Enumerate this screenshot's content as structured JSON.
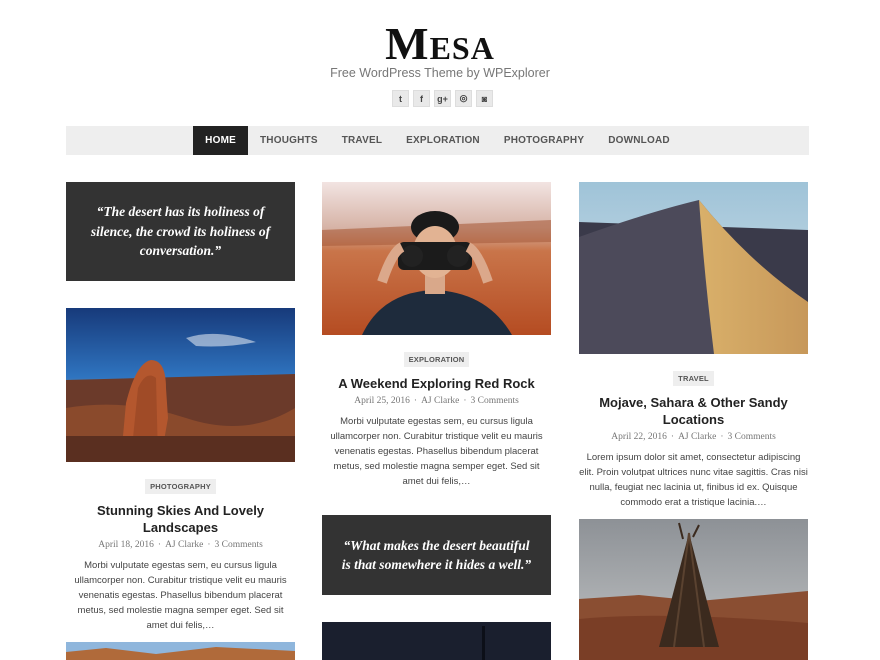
{
  "site": {
    "title": "Mesa",
    "tagline": "Free WordPress Theme by WPExplorer"
  },
  "social": [
    {
      "icon": "twitter-icon",
      "glyph": "t"
    },
    {
      "icon": "facebook-icon",
      "glyph": "f"
    },
    {
      "icon": "google-plus-icon",
      "glyph": "g+"
    },
    {
      "icon": "dribbble-icon",
      "glyph": "◎"
    },
    {
      "icon": "instagram-icon",
      "glyph": "◙"
    }
  ],
  "nav": {
    "items": [
      "HOME",
      "THOUGHTS",
      "TRAVEL",
      "EXPLORATION",
      "PHOTOGRAPHY",
      "DOWNLOAD"
    ],
    "active": "HOME"
  },
  "quotes": [
    "“The desert has its holiness of silence, the crowd its holiness of conversation.”",
    "“What makes the desert beautiful is that somewhere it hides a well.”"
  ],
  "posts": [
    {
      "category": "PHOTOGRAPHY",
      "title": "Stunning Skies And Lovely Landscapes",
      "date": "April 18, 2016",
      "author": "AJ Clarke",
      "comments": "3 Comments",
      "excerpt": "Morbi vulputate egestas sem, eu cursus ligula ullamcorper non. Curabitur tristique velit eu mauris venenatis egestas. Phasellus bibendum placerat metus, sed molestie magna semper eget. Sed sit amet dui felis,…"
    },
    {
      "category": "EXPLORATION",
      "title": "A Weekend Exploring Red Rock",
      "date": "April 25, 2016",
      "author": "AJ Clarke",
      "comments": "3 Comments",
      "excerpt": "Morbi vulputate egestas sem, eu cursus ligula ullamcorper non. Curabitur tristique velit eu mauris venenatis egestas. Phasellus bibendum placerat metus, sed molestie magna semper eget. Sed sit amet dui felis,…"
    },
    {
      "category": "TRAVEL",
      "title": "Mojave, Sahara & Other Sandy Locations",
      "date": "April 22, 2016",
      "author": "AJ Clarke",
      "comments": "3 Comments",
      "excerpt": "Lorem ipsum dolor sit amet, consectetur adipiscing elit. Proin volutpat ultrices nunc vitae sagittis. Cras nisi nulla, feugiat nec lacinia ut, finibus id ex. Quisque commodo erat a tristique lacinia.…"
    }
  ],
  "colors": {
    "nav_active_bg": "#222222",
    "nav_bg": "#eeeeee",
    "quote_bg": "#333333"
  }
}
